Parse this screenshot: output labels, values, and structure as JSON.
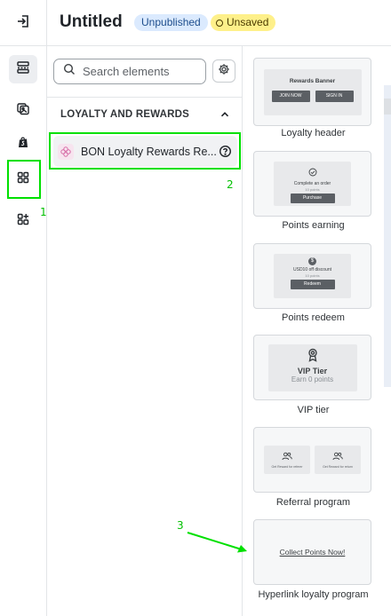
{
  "header": {
    "title": "Untitled",
    "status_badge": "Unpublished",
    "save_badge": "Unsaved"
  },
  "rail": {
    "items": [
      {
        "icon": "sections-icon",
        "selected": true
      },
      {
        "icon": "images-icon",
        "selected": false
      },
      {
        "icon": "shopify-bag-icon",
        "selected": false
      },
      {
        "icon": "apps-grid-icon",
        "selected": false
      },
      {
        "icon": "add-apps-icon",
        "selected": false
      }
    ]
  },
  "panel": {
    "search_placeholder": "Search elements",
    "section_title": "LOYALTY AND REWARDS",
    "app_name": "BON Loyalty Rewards Re..."
  },
  "previews": [
    {
      "label": "Loyalty header",
      "banner_title": "Rewards Banner",
      "btn1": "JOIN NOW",
      "btn2": "SIGN IN"
    },
    {
      "label": "Points earning",
      "line1": "Complete an order",
      "line2": "10 points",
      "btn": "Purchase"
    },
    {
      "label": "Points redeem",
      "icon_text": "$",
      "line1": "USD10 off discount",
      "line2": "10 points",
      "btn": "Redeem"
    },
    {
      "label": "VIP tier",
      "tier_name": "VIP Tier",
      "tier_points": "Earn 0 points"
    },
    {
      "label": "Referral program",
      "left_text": "Get Reward for referer",
      "right_text": "Get Reward for return"
    },
    {
      "label": "Hyperlink loyalty program",
      "link_text": "Collect Points Now!"
    }
  ],
  "annotations": [
    "1",
    "2",
    "3"
  ],
  "colors": {
    "highlight": "#00e000",
    "badge_unpublished_bg": "#dbeafe",
    "badge_unsaved_bg": "#fef08a"
  }
}
